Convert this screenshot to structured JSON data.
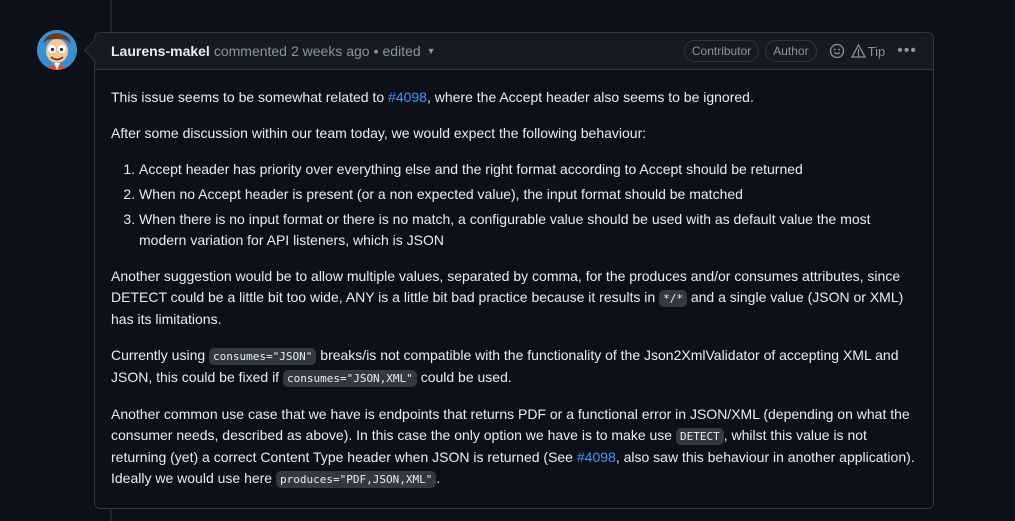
{
  "comment": {
    "author": "Laurens-makel",
    "action": "commented",
    "time": "2 weeks ago",
    "separator": "•",
    "edited": "edited",
    "badges": [
      "Contributor",
      "Author"
    ],
    "tip_label": "Tip",
    "more_label": "•••"
  },
  "body": {
    "p1_prefix": "This issue seems to be somewhat related to ",
    "p1_link": "#4098",
    "p1_suffix": ", where the Accept header also seems to be ignored.",
    "p2": "After some discussion within our team today, we would expect the following behaviour:",
    "list": [
      "Accept header has priority over everything else and the right format according to Accept should be returned",
      "When no Accept header is present (or a non expected value), the input format should be matched",
      "When there is no input format or there is no match, a configurable value should be used with as default value the most modern variation for API listeners, which is JSON"
    ],
    "p3_a": "Another suggestion would be to allow multiple values, separated by comma, for the produces and/or consumes attributes, since DETECT could be a little bit too wide, ANY is a little bit bad practice because it results in ",
    "p3_code": "*/*",
    "p3_b": " and a single value (JSON or XML) has its limitations.",
    "p4_a": "Currently using ",
    "p4_code1": "consumes=\"JSON\"",
    "p4_b": " breaks/is not compatible with the functionality of the Json2XmlValidator of accepting XML and JSON, this could be fixed if ",
    "p4_code2": "consumes=\"JSON,XML\"",
    "p4_c": " could be used.",
    "p5_a": "Another common use case that we have is endpoints that returns PDF or a functional error in JSON/XML (depending on what the consumer needs, described as above). In this case the only option we have is to make use ",
    "p5_code1": "DETECT",
    "p5_b": ", whilst this value is not returning (yet) a correct Content Type header when JSON is returned (See ",
    "p5_link": "#4098",
    "p5_c": ", also saw this behaviour in another application). Ideally we would use here ",
    "p5_code2": "produces=\"PDF,JSON,XML\"",
    "p5_d": "."
  }
}
